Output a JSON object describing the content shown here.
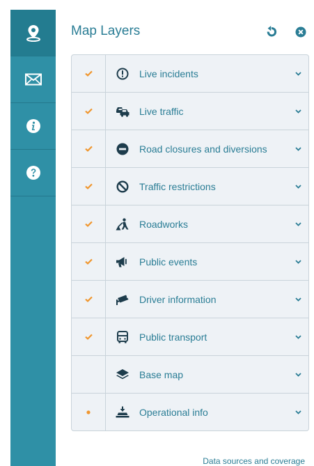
{
  "sidebar": {
    "items": [
      {
        "icon": "map-pin-icon",
        "active": true
      },
      {
        "icon": "envelope-icon",
        "active": false
      },
      {
        "icon": "info-icon",
        "active": false
      },
      {
        "icon": "help-icon",
        "active": false
      }
    ]
  },
  "panel": {
    "title": "Map Layers",
    "actions": [
      "refresh-icon",
      "close-icon"
    ]
  },
  "layers": [
    {
      "label": "Live incidents",
      "state": "checked",
      "icon": "alert-circle-icon"
    },
    {
      "label": "Live traffic",
      "state": "checked",
      "icon": "car-icon"
    },
    {
      "label": "Road closures and diversions",
      "state": "checked",
      "icon": "no-entry-icon"
    },
    {
      "label": "Traffic restrictions",
      "state": "checked",
      "icon": "prohibited-icon"
    },
    {
      "label": "Roadworks",
      "state": "checked",
      "icon": "roadworks-icon"
    },
    {
      "label": "Public events",
      "state": "checked",
      "icon": "megaphone-icon"
    },
    {
      "label": "Driver information",
      "state": "checked",
      "icon": "camera-icon"
    },
    {
      "label": "Public transport",
      "state": "checked",
      "icon": "bus-icon"
    },
    {
      "label": "Base map",
      "state": "none",
      "icon": "layers-icon"
    },
    {
      "label": "Operational info",
      "state": "partial",
      "icon": "operational-icon"
    }
  ],
  "footer": {
    "link": "Data sources and coverage"
  },
  "colors": {
    "sidebar": "#2f90a6",
    "accent": "#2a7d95",
    "check": "#f0962e",
    "icon": "#1d3c4c"
  }
}
